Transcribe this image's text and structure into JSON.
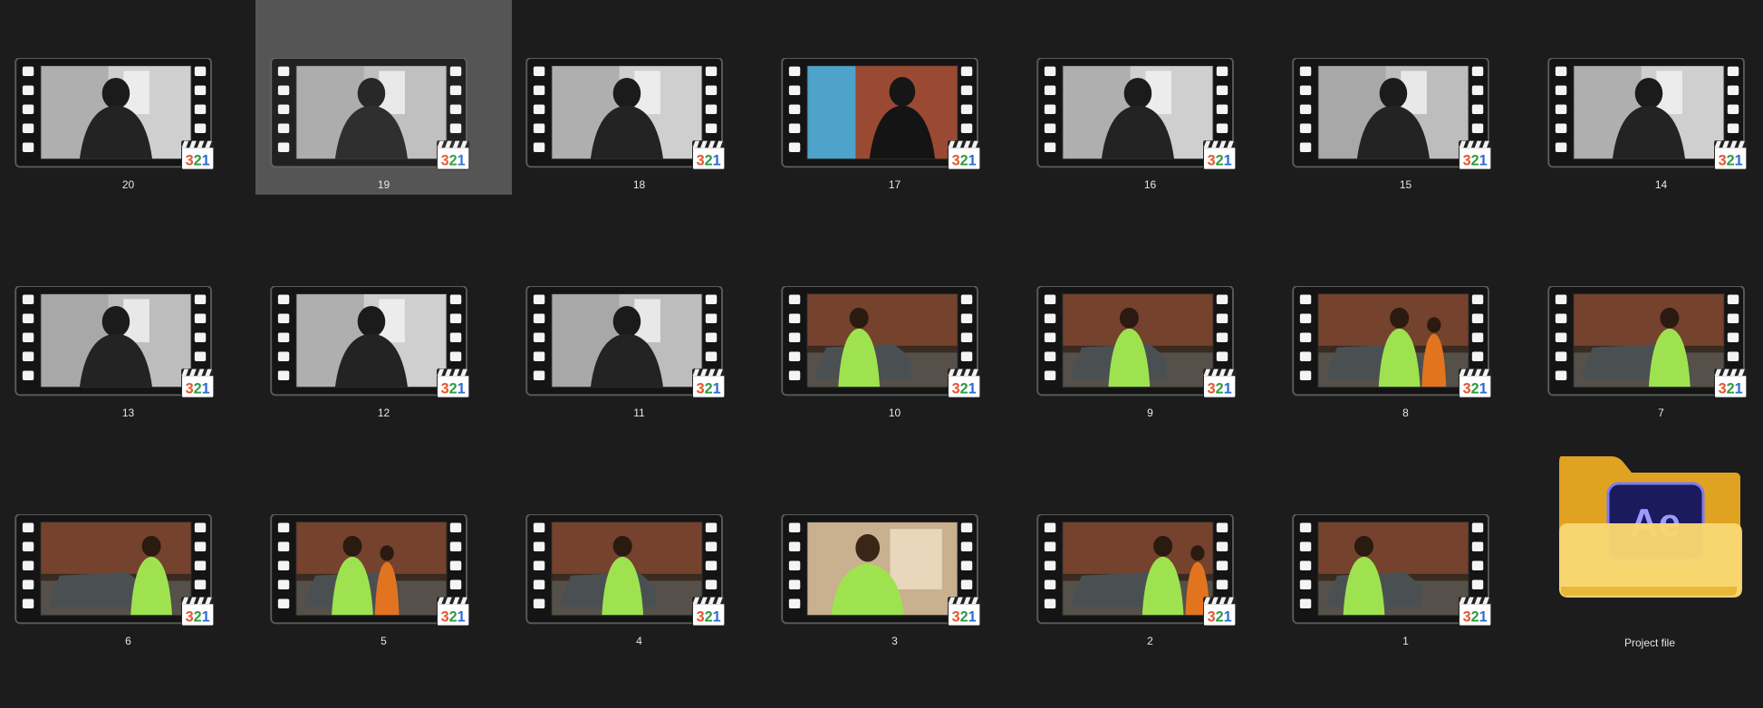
{
  "window": {
    "view": "Large icons",
    "background_color": "#1c1c1c",
    "selection_color": "#4b4b4b"
  },
  "files": [
    {
      "label": "20",
      "scene": "night-street-man-black-jacket",
      "selected": false,
      "tone": "bw"
    },
    {
      "label": "19",
      "scene": "road-markings-feet",
      "selected": true,
      "tone": "bw"
    },
    {
      "label": "18",
      "scene": "man-hood-closeup",
      "selected": false,
      "tone": "bw"
    },
    {
      "label": "17",
      "scene": "man-brick-wall-blue-door",
      "selected": false,
      "tone": "color"
    },
    {
      "label": "16",
      "scene": "man-hood-white-door",
      "selected": false,
      "tone": "bw"
    },
    {
      "label": "15",
      "scene": "man-hand-closeup",
      "selected": false,
      "tone": "bw"
    },
    {
      "label": "14",
      "scene": "street-houses-man",
      "selected": false,
      "tone": "bw"
    },
    {
      "label": "13",
      "scene": "man-walking-white-wall",
      "selected": false,
      "tone": "bw"
    },
    {
      "label": "12",
      "scene": "legs-walking-street",
      "selected": false,
      "tone": "bw"
    },
    {
      "label": "11",
      "scene": "man-hood-sitting",
      "selected": false,
      "tone": "bw"
    },
    {
      "label": "10",
      "scene": "man-green-suv-night",
      "selected": false,
      "tone": "night"
    },
    {
      "label": "9",
      "scene": "suv-two-men-night",
      "selected": false,
      "tone": "night"
    },
    {
      "label": "8",
      "scene": "suv-green-orange-night",
      "selected": false,
      "tone": "night"
    },
    {
      "label": "7",
      "scene": "man-green-brick-night",
      "selected": false,
      "tone": "night"
    },
    {
      "label": "6",
      "scene": "man-green-dance-orange",
      "selected": false,
      "tone": "night"
    },
    {
      "label": "5",
      "scene": "suv-men-wide-night",
      "selected": false,
      "tone": "night"
    },
    {
      "label": "4",
      "scene": "man-green-hands-face",
      "selected": false,
      "tone": "night"
    },
    {
      "label": "3",
      "scene": "man-green-indoor",
      "selected": false,
      "tone": "indoor"
    },
    {
      "label": "2",
      "scene": "man-green-cap-night",
      "selected": false,
      "tone": "night"
    },
    {
      "label": "1",
      "scene": "man-green-group-night",
      "selected": false,
      "tone": "night"
    }
  ],
  "folder": {
    "label": "Project file",
    "badge_text": "Ae",
    "icon": "after-effects-folder-icon",
    "folder_color": "#f6c646",
    "badge_color": "#1a1a5c",
    "badge_text_color": "#9a9cff"
  },
  "file_icon": "media-player-classic-icon",
  "file_icon_text": "321",
  "colors": {
    "bw_light": "#d9d9d9",
    "bw_dark": "#1b1b1b",
    "night_bg": "#3a2a20",
    "brick": "#8a4b31",
    "neon_green": "#9ee34f",
    "orange": "#e3741f",
    "suv": "#4a5052"
  }
}
